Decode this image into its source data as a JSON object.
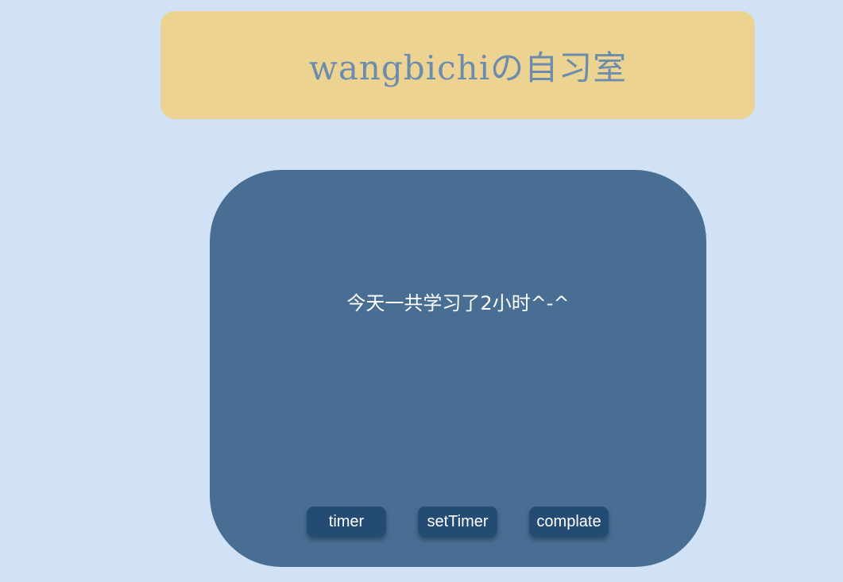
{
  "header": {
    "title": "wangbichiの自习室"
  },
  "main": {
    "study_summary": "今天一共学习了2小时^-^"
  },
  "buttons": {
    "timer": "timer",
    "set_timer": "setTimer",
    "complate": "complate"
  },
  "colors": {
    "page_background": "#d2e2f6",
    "header_background": "#edd391",
    "header_text": "#6b8cad",
    "card_background": "#486e94",
    "button_background": "#244b73",
    "button_text": "#ffffff"
  }
}
